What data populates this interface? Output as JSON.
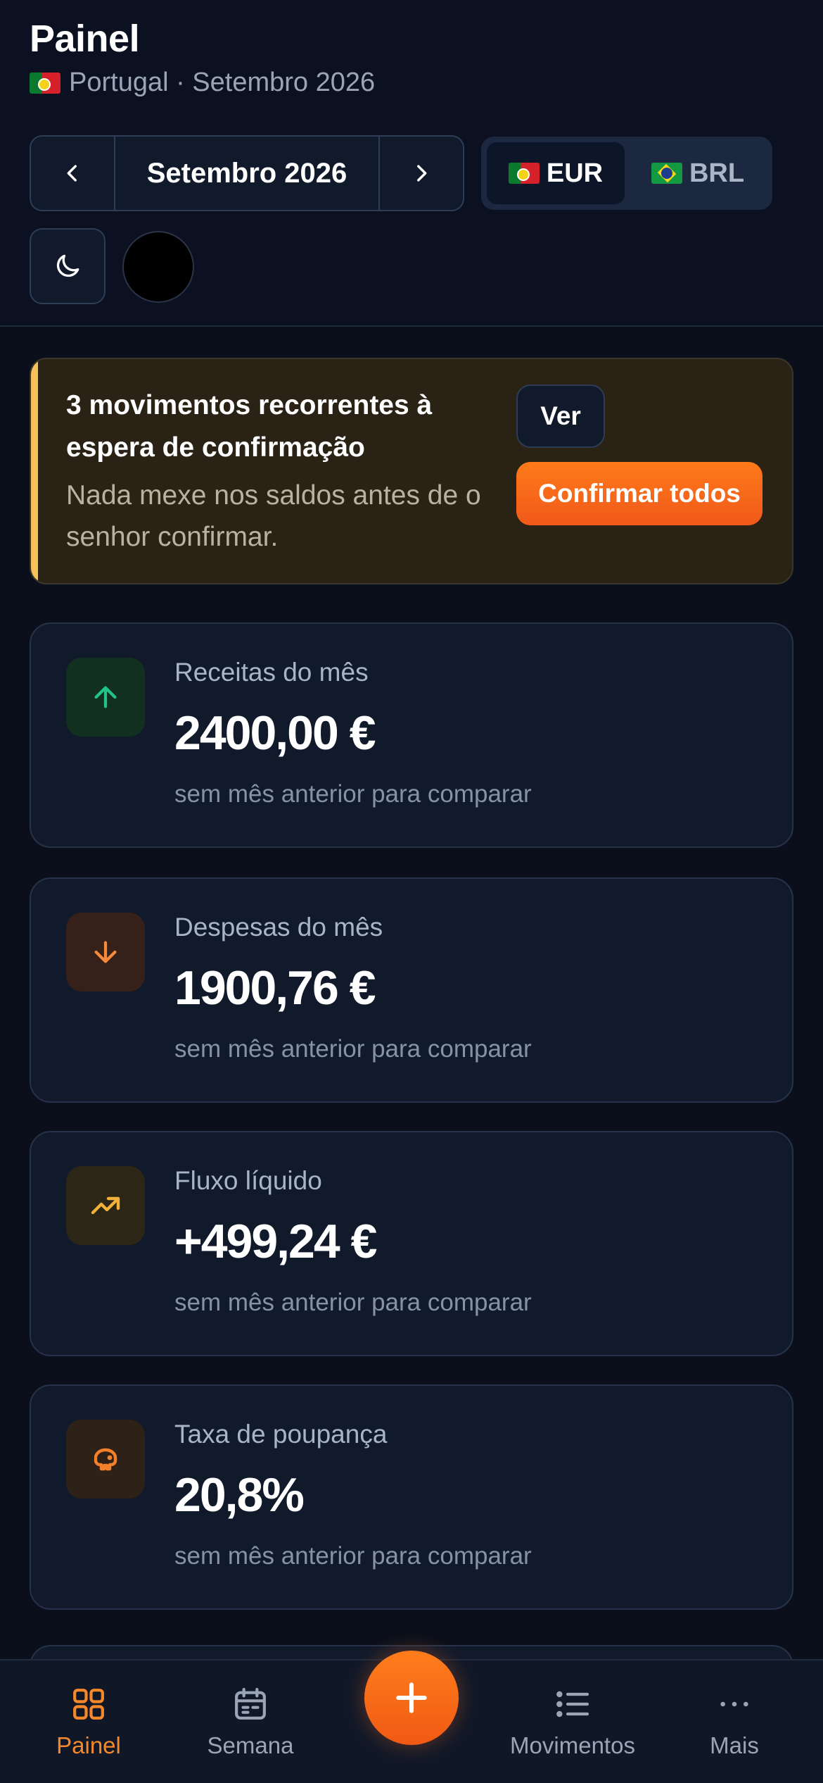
{
  "header": {
    "title": "Painel",
    "subtitle": "Portugal · Setembro 2026",
    "month_label": "Setembro 2026",
    "currency": [
      {
        "code": "EUR",
        "active": true
      },
      {
        "code": "BRL",
        "active": false
      }
    ]
  },
  "alert": {
    "title": "3 movimentos recorrentes à espera de confirmação",
    "body": "Nada mexe nos saldos antes de o senhor confirmar.",
    "view_label": "Ver",
    "confirm_label": "Confirmar todos"
  },
  "stats": [
    {
      "label": "Receitas do mês",
      "value": "2400,00 €",
      "note": "sem mês anterior para comparar",
      "icon": "arrow-up-icon",
      "color": "#22c38a"
    },
    {
      "label": "Despesas do mês",
      "value": "1900,76 €",
      "note": "sem mês anterior para comparar",
      "icon": "arrow-down-icon",
      "color": "#f6893a"
    },
    {
      "label": "Fluxo líquido",
      "value": "+499,24 €",
      "note": "sem mês anterior para comparar",
      "icon": "trend-up-icon",
      "color": "#f2b13a"
    },
    {
      "label": "Taxa de poupança",
      "value": "20,8%",
      "note": "sem mês anterior para comparar",
      "icon": "piggy-bank-icon",
      "color": "#f5802a"
    }
  ],
  "bottom_nav": {
    "items": [
      {
        "label": "Painel",
        "icon": "grid-icon",
        "active": true
      },
      {
        "label": "Semana",
        "icon": "calendar-icon",
        "active": false
      },
      {
        "label": "Movimentos",
        "icon": "list-icon",
        "active": false
      },
      {
        "label": "Mais",
        "icon": "more-icon",
        "active": false
      }
    ],
    "fab_icon": "plus-icon"
  },
  "colors": {
    "accent": "#f7882a",
    "background": "#0a0f1b",
    "card": "#111a2b"
  }
}
